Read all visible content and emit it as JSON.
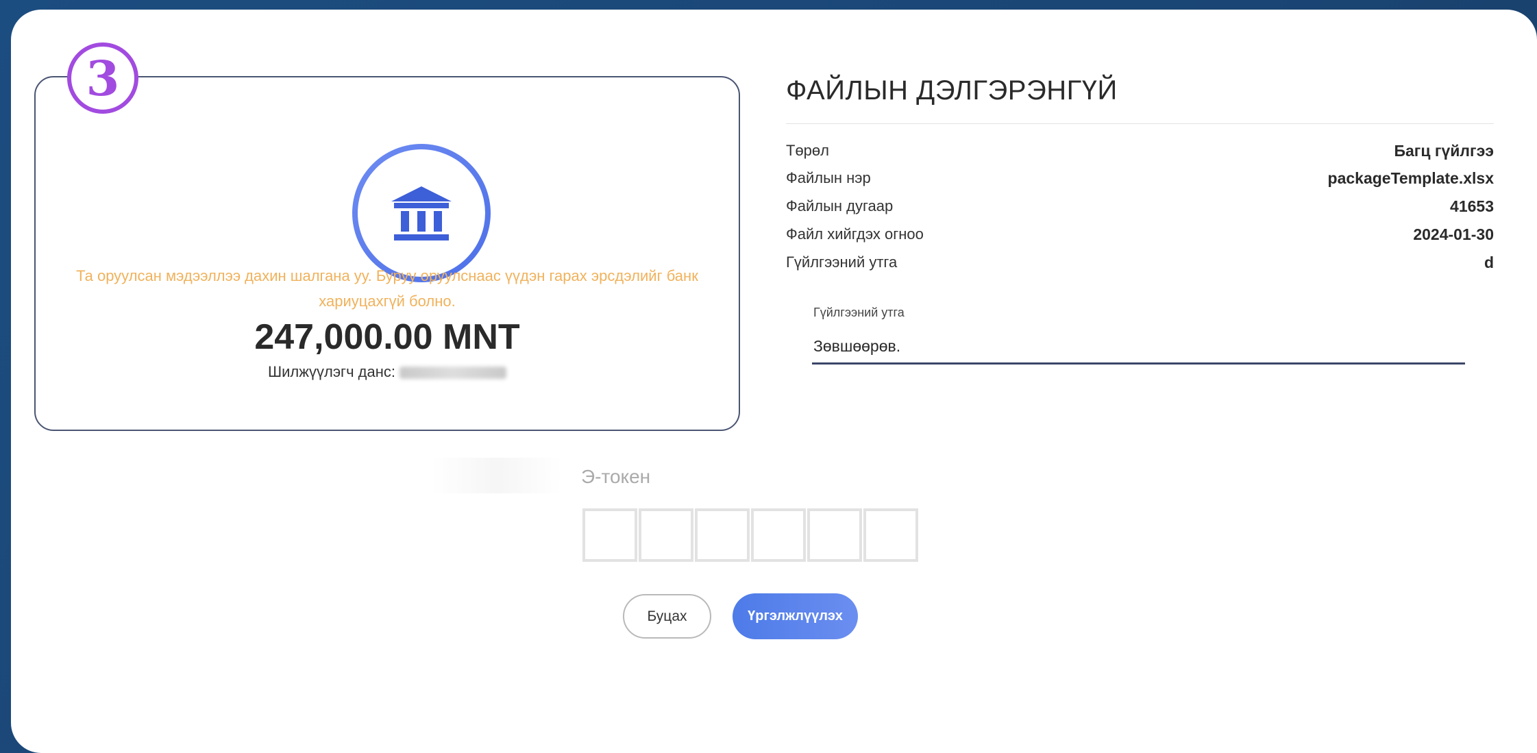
{
  "step": {
    "number": "3"
  },
  "summary": {
    "icon": "bank-icon",
    "warning": "Та оруулсан мэдээллээ дахин шалгана уу. Буруу оруулснаас үүдэн гарах эрсдэлийг банк хариуцахгүй болно.",
    "amount": "247,000.00 MNT",
    "sender_label": "Шилжүүлэгч данс:"
  },
  "details": {
    "title": "ФАЙЛЫН ДЭЛГЭРЭНГҮЙ",
    "rows": [
      {
        "label": "Төрөл",
        "value": "Багц гүйлгээ"
      },
      {
        "label": "Файлын нэр",
        "value": "packageTemplate.xlsx"
      },
      {
        "label": "Файлын дугаар",
        "value": "41653"
      },
      {
        "label": "Файл хийгдэх огноо",
        "value": "2024-01-30"
      },
      {
        "label": "Гүйлгээний утга",
        "value": "d"
      }
    ]
  },
  "note": {
    "label": "Гүйлгээний утга",
    "value": "Зөвшөөрөв."
  },
  "token": {
    "label": "Э-токен"
  },
  "actions": {
    "back_label": "Буцах",
    "continue_label": "Үргэлжлүүлэх"
  },
  "colors": {
    "accent": "#4d7be8",
    "warning": "#f0b25c",
    "step_badge": "#a24be0",
    "background": "#1a4574"
  }
}
